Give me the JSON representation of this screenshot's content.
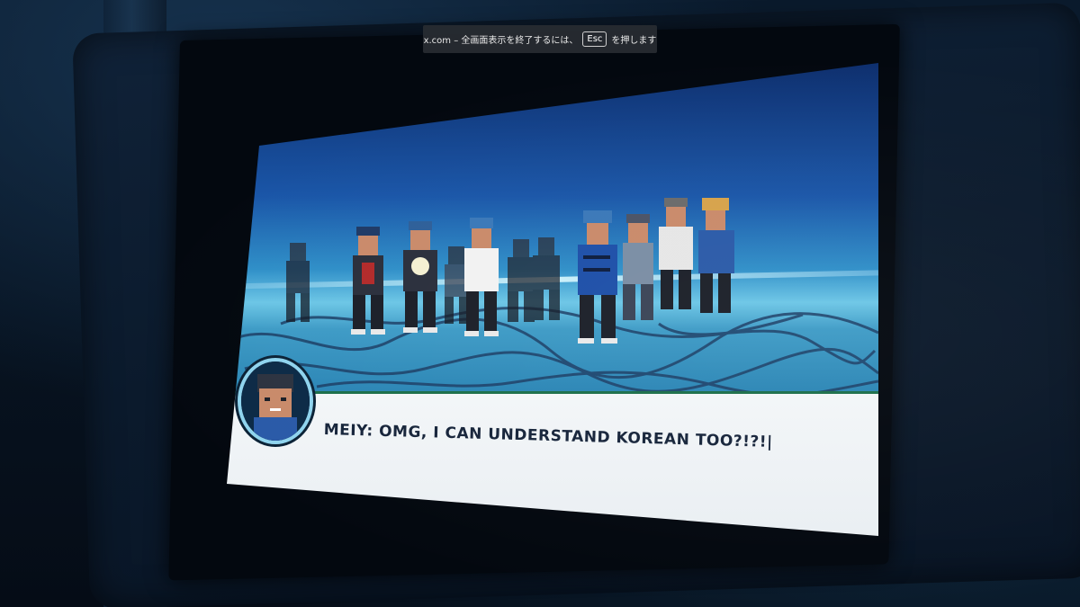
{
  "fullscreen_notice": {
    "prefix": "x.com – 全画面表示を終了するには、",
    "key": "Esc",
    "suffix": "を押します"
  },
  "game": {
    "dialog": {
      "text": "MEIY: OMG, I CAN UNDERSTAND KOREAN TOO?!?!",
      "cursor": "|"
    }
  },
  "colors": {
    "sky_top": "#0e2f6e",
    "floor_glow": "#6cc6e6",
    "dialog_bg": "#f3f6f8",
    "dialog_border": "#1c6f4a",
    "portrait_ring": "#8fd4ee"
  },
  "icons": {
    "portrait": "character-portrait-icon"
  }
}
